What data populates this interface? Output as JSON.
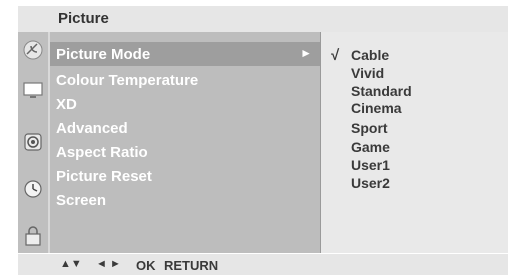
{
  "header": {
    "title": "Picture"
  },
  "icon_bar": [
    {
      "icon": "satellite-dish-icon"
    },
    {
      "icon": "tv-monitor-icon"
    },
    {
      "icon": "speaker-icon"
    },
    {
      "icon": "clock-icon"
    },
    {
      "icon": "lock-icon"
    }
  ],
  "menu": {
    "items": [
      {
        "label": "Picture Mode"
      },
      {
        "label": "Colour Temperature"
      },
      {
        "label": "XD"
      },
      {
        "label": "Advanced"
      },
      {
        "label": "Aspect Ratio"
      },
      {
        "label": "Picture Reset"
      },
      {
        "label": "Screen"
      }
    ],
    "active_arrow": "►"
  },
  "options": {
    "checkmark": "√",
    "items": [
      "Cable",
      "Vivid",
      "Standard",
      "Cinema",
      "Sport",
      "Game",
      "User1",
      "User2"
    ]
  },
  "footer": {
    "updown_label": "▲▼",
    "leftright_label": "◄ ►",
    "ok_label": "OK",
    "return_label": "RETURN"
  },
  "colors": {
    "menu_bg": "#bdbdbd",
    "active_bg": "#9e9e9e",
    "options_bg": "#e9e9e9",
    "header_bg": "#e6e6e6"
  }
}
